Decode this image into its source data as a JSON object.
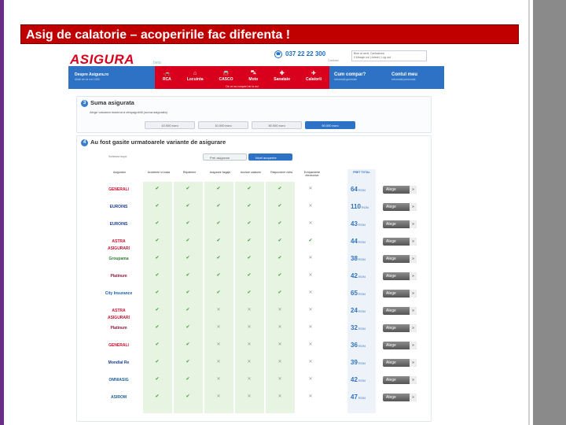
{
  "slide": {
    "title": "Asig de calatorie – acoperirile fac diferenta !"
  },
  "site": {
    "logo": "ASIGURA",
    "logo_sub": "beta",
    "phone": "037 22 22 300",
    "phone_sub": "Contact",
    "account": [
      "Bine ai venit, Caresalcea",
      "0 Mesaje noi | Admin | Log out"
    ]
  },
  "nav": {
    "despre": {
      "label": "Despre Asigura.ro",
      "sub": "Aflati de ce noi 1000"
    },
    "red_items": [
      "RCA",
      "Locuinta",
      "CASCO",
      "Moto",
      "Sanatate",
      "Calatorii"
    ],
    "red_foot": "De ce sa cumperi de la noi",
    "blue_items": [
      {
        "label": "Cum compar?",
        "sub": "Informatii generale"
      },
      {
        "label": "Contul meu",
        "sub": "Informatii personale"
      }
    ]
  },
  "step3": {
    "num": "3",
    "title": "Suma asigurata",
    "desc": "Alege valoarea maxima a despagubirii (suma asigurata)",
    "options": [
      {
        "label": "10.000 euro",
        "selected": false
      },
      {
        "label": "10.000 euro",
        "selected": false
      },
      {
        "label": "30.000 euro",
        "selected": false
      },
      {
        "label": "50.000 euro",
        "selected": true
      }
    ]
  },
  "step4": {
    "num": "4",
    "title": "Au fost gasite urmatoarele variante de asigurare",
    "sort_label": "Sorteaza dupa:",
    "sort_options": [
      {
        "label": "Pret asigurare",
        "selected": false
      },
      {
        "label": "Nivel acoperire",
        "selected": true
      }
    ],
    "columns": [
      "Asigurator",
      "Accidente si boala",
      "Repatriere",
      "Asigurare bagaje",
      "Anulare calatorie",
      "Raspundere civila",
      "Echipamente electronice",
      "PRET TOTAL"
    ],
    "button_label": "Alege",
    "currency": "RON",
    "rows": [
      {
        "insurer": "GENERALI",
        "marks": [
          true,
          true,
          true,
          true,
          true,
          false
        ],
        "price": "64"
      },
      {
        "insurer": "EUROINS",
        "marks": [
          true,
          true,
          true,
          true,
          true,
          false
        ],
        "price": "110"
      },
      {
        "insurer": "EUROINS",
        "marks": [
          true,
          true,
          true,
          true,
          true,
          false
        ],
        "price": "43"
      },
      {
        "insurer": "ASTRA ASIGURARI",
        "marks": [
          true,
          true,
          true,
          true,
          true,
          true
        ],
        "price": "44"
      },
      {
        "insurer": "Groupama",
        "marks": [
          true,
          true,
          true,
          true,
          true,
          false
        ],
        "price": "38"
      },
      {
        "insurer": "Platinum",
        "marks": [
          true,
          true,
          true,
          true,
          true,
          false
        ],
        "price": "42"
      },
      {
        "insurer": "City Insurance",
        "marks": [
          true,
          true,
          true,
          true,
          true,
          false
        ],
        "price": "65"
      },
      {
        "insurer": "ASTRA ASIGURARI",
        "marks": [
          true,
          true,
          false,
          false,
          false,
          false
        ],
        "price": "24"
      },
      {
        "insurer": "Platinum",
        "marks": [
          true,
          true,
          false,
          false,
          false,
          false
        ],
        "price": "32"
      },
      {
        "insurer": "GENERALI",
        "marks": [
          true,
          true,
          false,
          false,
          false,
          false
        ],
        "price": "36"
      },
      {
        "insurer": "Mondial Re",
        "marks": [
          true,
          true,
          false,
          false,
          false,
          false
        ],
        "price": "39"
      },
      {
        "insurer": "OMNIASIG",
        "marks": [
          true,
          true,
          false,
          false,
          false,
          false
        ],
        "price": "42"
      },
      {
        "insurer": "ASIROM",
        "marks": [
          true,
          true,
          false,
          false,
          false,
          false
        ],
        "price": "47"
      }
    ],
    "logo_colors": [
      "#c8102e",
      "#1c3f94",
      "#1c3f94",
      "#c8102e",
      "#2e7d32",
      "#8a1c3c",
      "#1a5ea8",
      "#c8102e",
      "#8a1c3c",
      "#c8102e",
      "#1c3f94",
      "#1f5f99",
      "#1f5f99"
    ]
  }
}
